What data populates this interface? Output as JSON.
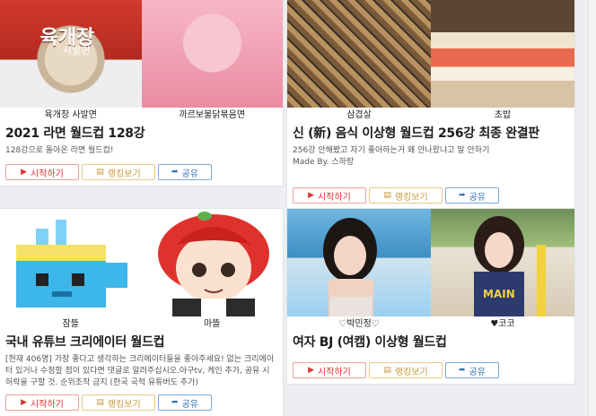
{
  "cards": [
    {
      "thumbs": [
        "육개장 사발면",
        "까르보불닭볶음면"
      ],
      "title": "2021 라면 월드컵 128강",
      "desc": "128강으로 돌아온 라면 월드컵!",
      "buttons": {
        "start": "시작하기",
        "rank": "랭킹보기",
        "share": "공유"
      }
    },
    {
      "thumbs": [
        "삼겹살",
        "초밥"
      ],
      "title": "신 (新) 음식 이상형 월드컵 256강 최종 완결판",
      "desc": "256강 안해봤고 자기 좋아하는거 왜 안나왔냐고 말 안하기\nMade By. 스하랑",
      "buttons": {
        "start": "시작하기",
        "rank": "랭킹보기",
        "share": "공유"
      }
    },
    {
      "thumbs": [
        "잠뜰",
        "마뜰"
      ],
      "title": "국내 유튜브 크리에이터 월드컵",
      "desc": "[현재 406명] 가장 좋다고 생각하는 크리에이터들을 좋아주세요! 없는 크리에이터 있거나 수정할 점이 있다면 댓글로 알려주십시오.아구tv, 케인 추가, 공유 시 허락을 구할 것. 순위조작 금지 (한국 국적 유튜버도 추가)",
      "buttons": {
        "start": "시작하기",
        "rank": "랭킹보기",
        "share": "공유"
      }
    },
    {
      "thumbs": [
        "♡박민정♡",
        "♥코코"
      ],
      "title": "여자 BJ (여캠) 이상형 월드컵",
      "desc": "",
      "buttons": {
        "start": "시작하기",
        "rank": "랭킹보기",
        "share": "공유"
      }
    }
  ],
  "thumb_text": {
    "ramen_brand": "육개장",
    "ramen_sub": "사발면",
    "jersey": "MAIN"
  }
}
